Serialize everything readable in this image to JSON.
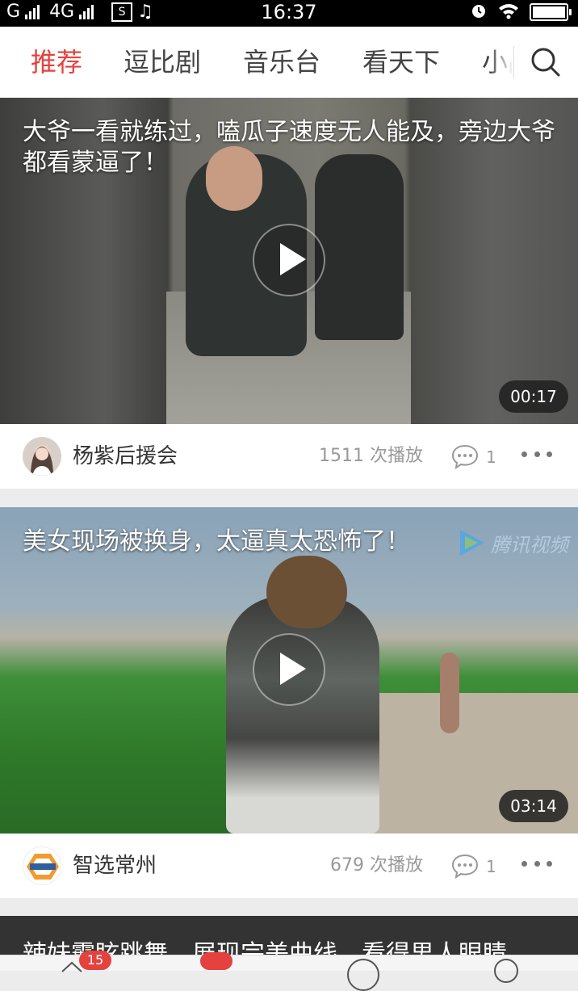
{
  "status_bar": {
    "carrier": "G",
    "network": "4G",
    "time": "16:37",
    "icons": [
      "signal-icon",
      "sim-icon",
      "music-icon",
      "alarm-icon",
      "wifi-icon",
      "battery-icon"
    ]
  },
  "tabs": [
    {
      "label": "推荐",
      "active": true
    },
    {
      "label": "逗比剧"
    },
    {
      "label": "音乐台"
    },
    {
      "label": "看天下"
    },
    {
      "label": "小品"
    }
  ],
  "feed": [
    {
      "title": "大爷一看就练过，嗑瓜子速度无人能及，旁边大爷都看蒙逼了！",
      "duration": "00:17",
      "author": "杨紫后援会",
      "plays": "1511 次播放",
      "comments": "1"
    },
    {
      "title": "美女现场被换身，太逼真太恐怖了！",
      "watermark": "腾讯视频",
      "duration": "03:14",
      "author": "智选常州",
      "avatar_text": "智选常州",
      "plays": "679 次播放",
      "comments": "1"
    },
    {
      "title": "辣妹霸眩跳舞，展现完美曲线，看得男人眼睛"
    }
  ],
  "bottom_nav": {
    "badge": "15"
  },
  "colors": {
    "accent": "#e5413e",
    "background": "#ececec"
  }
}
